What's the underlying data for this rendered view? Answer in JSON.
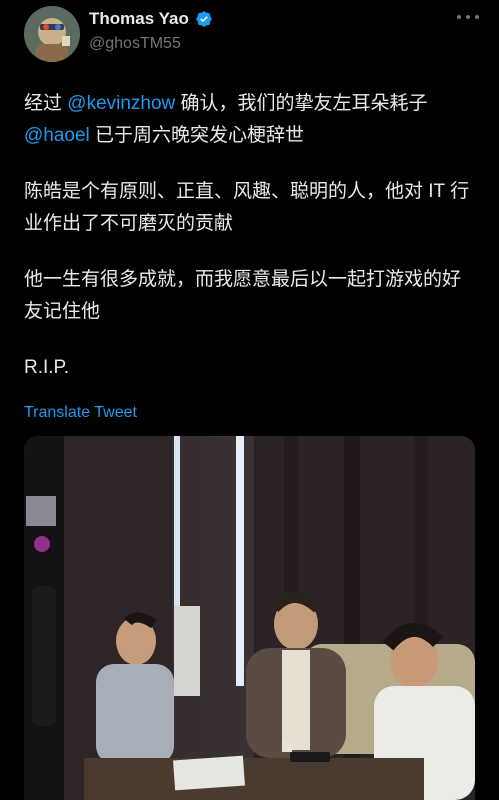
{
  "author": {
    "display_name": "Thomas Yao",
    "handle": "@ghosTM55",
    "verified": true
  },
  "tweet": {
    "p1_prefix": "经过 ",
    "p1_mention1": "@kevinzhow",
    "p1_middle": " 确认，我们的挚友左耳朵耗子",
    "p1_mention2": "@haoel",
    "p1_suffix": " 已于周六晚突发心梗辞世",
    "p2": "陈皓是个有原则、正直、风趣、聪明的人，他对 IT 行业作出了不可磨灭的贡献",
    "p3": "他一生有很多成就，而我愿意最后以一起打游戏的好友记住他",
    "p4": "R.I.P."
  },
  "translate_label": "Translate Tweet",
  "colors": {
    "background": "#000000",
    "text": "#e7e9ea",
    "secondary": "#71767b",
    "accent": "#1d9bf0"
  },
  "icons": [
    "verified-badge-icon",
    "more-options-icon"
  ],
  "media": {
    "type": "photo"
  }
}
